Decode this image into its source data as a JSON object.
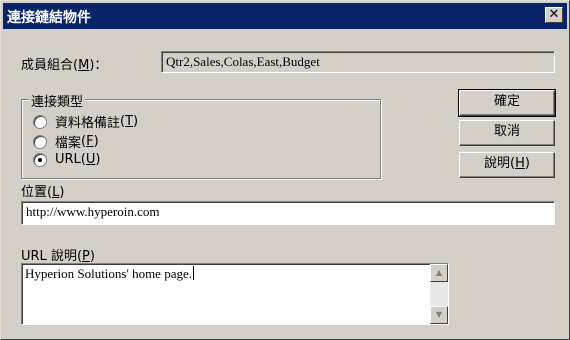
{
  "window": {
    "title": "連接鏈結物件",
    "close_glyph": "✕"
  },
  "member_combo": {
    "label": "成員組合",
    "accel": "M",
    "suffix": "：",
    "value": "Qtr2,Sales,Colas,East,Budget"
  },
  "link_type": {
    "title": "連接類型",
    "options": [
      {
        "label": "資料格備註",
        "accel": "T",
        "selected": false
      },
      {
        "label": "檔案",
        "accel": "F",
        "selected": false
      },
      {
        "label": "URL",
        "accel": "U",
        "selected": true
      }
    ]
  },
  "buttons": {
    "ok": "確定",
    "cancel": "取消",
    "help_label": "說明",
    "help_accel": "H"
  },
  "location": {
    "label": "位置",
    "accel": "L",
    "value": "http://www.hyperoin.com"
  },
  "url_desc": {
    "label": "URL 說明",
    "accel": "P",
    "value": "Hyperion Solutions' home page."
  }
}
